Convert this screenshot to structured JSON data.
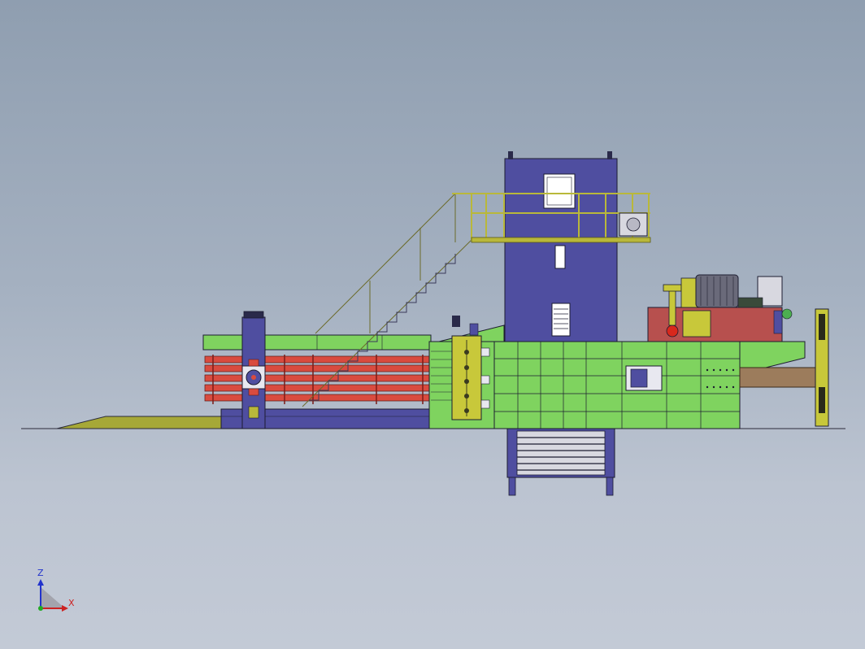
{
  "triad": {
    "z_label": "Z",
    "x_label": "X"
  },
  "colors": {
    "frame_green": "#7fd35f",
    "hopper_blue": "#4f4ea0",
    "cylinder_red": "#d94b3f",
    "tank_red": "#b7504e",
    "railing_yellow": "#b9b83a",
    "ram_tan": "#9c7c5c",
    "outline": "#1c1c30"
  }
}
